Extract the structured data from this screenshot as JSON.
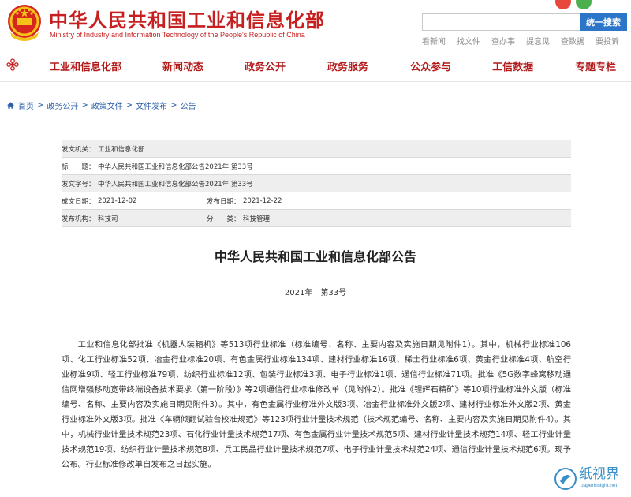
{
  "header": {
    "title": "中华人民共和国工业和信息化部",
    "subtitle": "Ministry of Industry and Information Technology of the People's Republic of China",
    "top_right_text": "···",
    "search": {
      "value": "",
      "placeholder": "",
      "button_label": "统一搜索"
    },
    "quick_links": [
      "看新闻",
      "找文件",
      "查办事",
      "提意见",
      "查数据",
      "要投诉"
    ],
    "colors": {
      "brand_red": "#c71f1f",
      "search_blue": "#2b76c8"
    }
  },
  "nav": {
    "home_icon": "flower-icon",
    "items": [
      "工业和信息化部",
      "新闻动态",
      "政务公开",
      "政务服务",
      "公众参与",
      "工信数据",
      "专题专栏"
    ]
  },
  "breadcrumb": {
    "home_icon": "home-icon",
    "items": [
      "首页",
      "政务公开",
      "政策文件",
      "文件发布",
      "公告"
    ]
  },
  "meta": {
    "issuer": {
      "label": "发文机关：",
      "value": "工业和信息化部"
    },
    "title": {
      "label": "标　　题：",
      "value": "中华人民共和国工业和信息化部公告2021年 第33号"
    },
    "doc_no": {
      "label": "发文字号：",
      "value": "中华人民共和国工业和信息化部公告2021年 第33号"
    },
    "created": {
      "label": "成文日期：",
      "value": "2021-12-02"
    },
    "published": {
      "label": "发布日期：",
      "value": "2021-12-22"
    },
    "org": {
      "label": "发布机构：",
      "value": "科技司"
    },
    "category": {
      "label": "分　　类：",
      "value": "科技管理"
    }
  },
  "document": {
    "title": "中华人民共和国工业和信息化部公告",
    "number": "2021年　第33号",
    "body": "工业和信息化部批准《机器人装箱机》等513项行业标准（标准编号、名称、主要内容及实施日期见附件1）。其中，机械行业标准106项、化工行业标准52项、冶金行业标准20项、有色金属行业标准134项、建材行业标准16项、稀土行业标准6项、黄金行业标准4项、航空行业标准9项、轻工行业标准79项、纺织行业标准12项、包装行业标准3项、电子行业标准1项、通信行业标准71项。批准《5G数字蜂窝移动通信网增强移动宽带终端设备技术要求（第一阶段）》等2项通信行业标准修改单（见附件2）。批准《锂辉石精矿》等10项行业标准外文版（标准编号、名称、主要内容及实施日期见附件3）。其中，有色金属行业标准外文版3项、冶金行业标准外文版2项、建材行业标准外文版2项、黄金行业标准外文版3项。批准《车辆倾翻试验台校准规范》等123项行业计量技术规范（技术规范编号、名称、主要内容及实施日期见附件4）。其中，机械行业计量技术规范23项、石化行业计量技术规范17项、有色金属行业计量技术规范5项、建材行业计量技术规范14项、轻工行业计量技术规范19项、纺织行业计量技术规范8项、兵工民品行业计量技术规范7项、电子行业计量技术规范24项、通信行业计量技术规范6项。现予公布。行业标准修改单自发布之日起实施。"
  },
  "watermark": {
    "cn": "纸视界",
    "url": "paperinsight.net"
  }
}
